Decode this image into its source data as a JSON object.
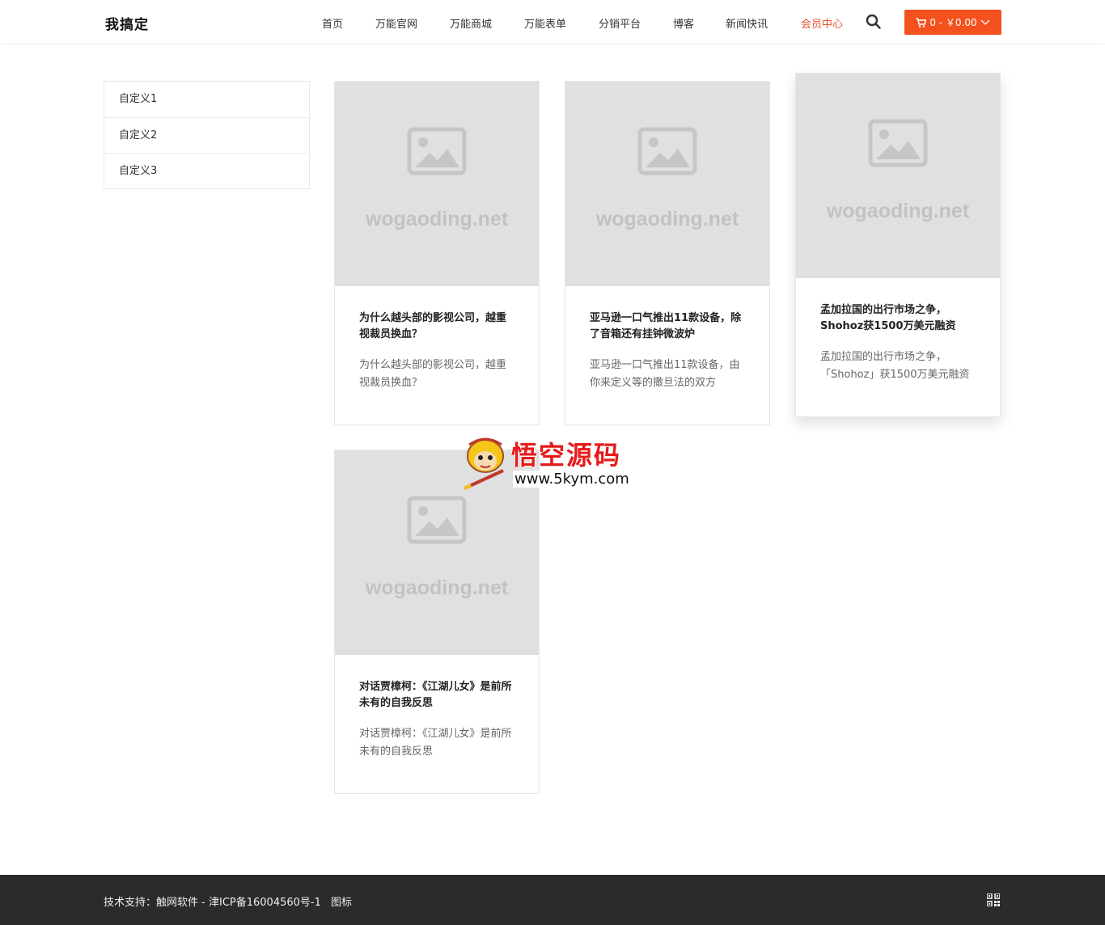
{
  "header": {
    "logo": "我搞定",
    "nav": [
      {
        "label": "首页"
      },
      {
        "label": "万能官网"
      },
      {
        "label": "万能商城"
      },
      {
        "label": "万能表单"
      },
      {
        "label": "分销平台"
      },
      {
        "label": "博客"
      },
      {
        "label": "新闻快讯"
      },
      {
        "label": "会员中心",
        "active": true
      }
    ],
    "cart_label": "0 - ￥0.00",
    "accent_color": "#f4511e"
  },
  "sidebar": {
    "items": [
      {
        "label": "自定义1"
      },
      {
        "label": "自定义2"
      },
      {
        "label": "自定义3"
      }
    ]
  },
  "cards": [
    {
      "thumb_text": "wogaoding.net",
      "title": "为什么越头部的影视公司，越重视裁员换血？",
      "desc": "为什么越头部的影视公司，越重视裁员换血？"
    },
    {
      "thumb_text": "wogaoding.net",
      "title": "亚马逊一口气推出11款设备，除了音箱还有挂钟微波炉",
      "desc": "亚马逊一口气推出11款设备，由你来定义等的撒旦法的双方"
    },
    {
      "thumb_text": "wogaoding.net",
      "title": "孟加拉国的出行市场之争，Shohoz获1500万美元融资",
      "desc": "孟加拉国的出行市场之争，「Shohoz」获1500万美元融资"
    },
    {
      "thumb_text": "wogaoding.net",
      "title": "对话贾樟柯：《江湖儿女》是前所未有的自我反思",
      "desc": "对话贾樟柯：《江湖儿女》是前所未有的自我反思"
    }
  ],
  "watermark": {
    "title": "悟空源码",
    "url": "www.5kym.com"
  },
  "footer": {
    "support": "技术支持：触网软件",
    "separator": " - ",
    "icp": "津ICP备16004560号-1",
    "icon_link": "图标"
  }
}
